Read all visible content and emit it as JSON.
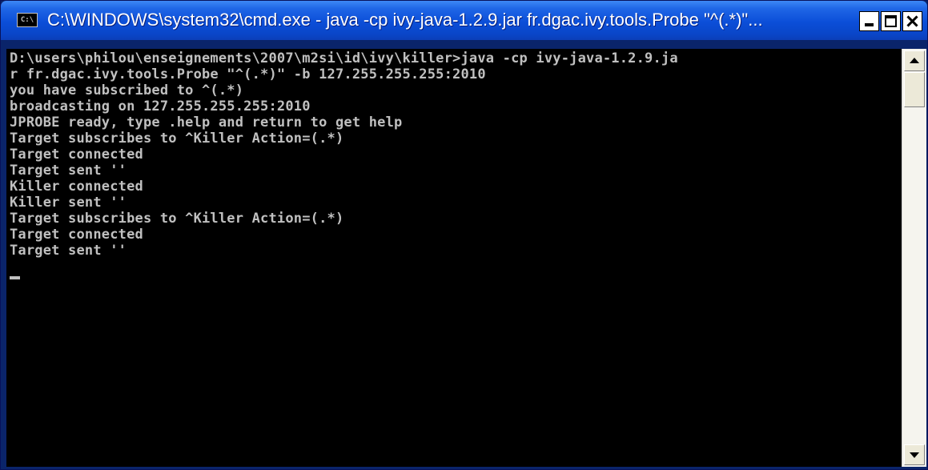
{
  "window": {
    "title": "C:\\WINDOWS\\system32\\cmd.exe - java -cp ivy-java-1.2.9.jar fr.dgac.ivy.tools.Probe \"^(.*)\"...",
    "icon_label": "C:\\",
    "icon": "cmd-app-icon",
    "controls": {
      "minimize": "minimize-icon",
      "maximize": "maximize-icon",
      "close": "close-icon"
    }
  },
  "console": {
    "lines": [
      "D:\\users\\philou\\enseignements\\2007\\m2si\\id\\ivy\\killer>java -cp ivy-java-1.2.9.ja",
      "r fr.dgac.ivy.tools.Probe \"^(.*)\" -b 127.255.255.255:2010",
      "you have subscribed to ^(.*)",
      "broadcasting on 127.255.255.255:2010",
      "JPROBE ready, type .help and return to get help",
      "Target subscribes to ^Killer Action=(.*)",
      "Target connected",
      "Target sent ''",
      "Killer connected",
      "Killer sent ''",
      "Target subscribes to ^Killer Action=(.*)",
      "Target connected",
      "Target sent ''"
    ]
  },
  "colors": {
    "title_bar": "#0b4ed8",
    "console_background": "#000000",
    "console_text": "#c0c0c0"
  }
}
